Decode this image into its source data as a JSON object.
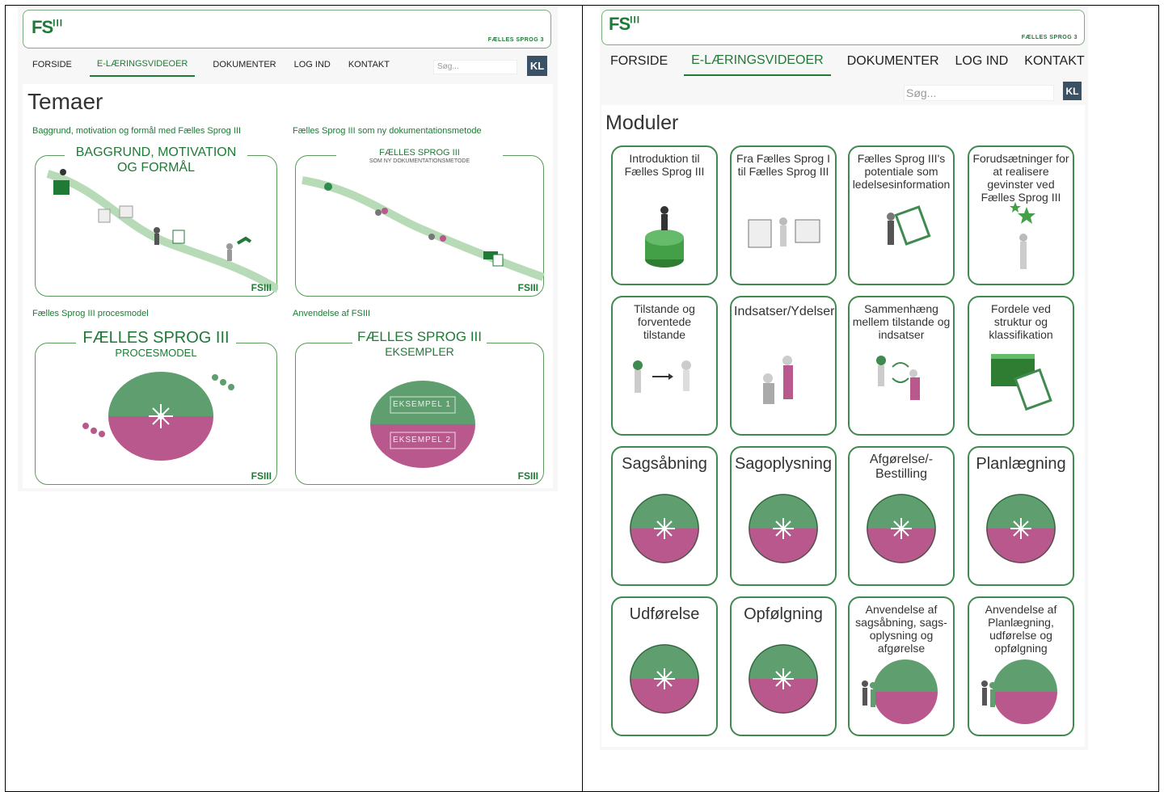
{
  "brand": {
    "logo": "FS",
    "logo_suffix": "III",
    "tagline": "FÆLLES SPROG 3",
    "accent": "#1f7a36",
    "green": "#5f9e6e",
    "pink": "#b8588c"
  },
  "nav": {
    "items": [
      "FORSIDE",
      "E-LÆRINGSVIDEOER",
      "DOKUMENTER",
      "LOG IND",
      "KONTAKT"
    ],
    "active": 1,
    "search_placeholder": "Søg...",
    "kl_label": "KL"
  },
  "left": {
    "title": "Temaer",
    "sections": [
      {
        "heading": "Baggrund, motivation og formål med Fælles Sprog III",
        "thumb_title": "BAGGRUND, MOTIVATION OG FORMÅL",
        "thumb_sub": ""
      },
      {
        "heading": "Fælles Sprog III som ny dokumentationsmetode",
        "thumb_title": "FÆLLES SPROG III",
        "thumb_sub": "SOM NY DOKUMENTATIONSMETODE"
      },
      {
        "heading": "Fælles Sprog III procesmodel",
        "thumb_title": "FÆLLES SPROG III",
        "thumb_sub": "PROCESMODEL"
      },
      {
        "heading": "Anvendelse af FSIII",
        "thumb_title": "FÆLLES SPROG III",
        "thumb_sub": "EKSEMPLER"
      }
    ],
    "examples": [
      "EKSEMPEL 1",
      "EKSEMPEL 2"
    ],
    "fs_mark": "FSIII"
  },
  "right": {
    "title": "Moduler",
    "modules": [
      {
        "label": "Introduktion til Fælles Sprog III",
        "icon": "chart-figure-icon"
      },
      {
        "label": "Fra Fælles Sprog I til Fælles Sprog III",
        "icon": "fsi-fsiii-icon"
      },
      {
        "label": "Fælles Sprog III's potentiale som ledelsesinformation",
        "icon": "clipboard-figure-icon"
      },
      {
        "label": "Forudsætninger for at realisere gevinster ved Fælles Sprog III",
        "icon": "stars-figure-icon"
      },
      {
        "label": "Tilstande og forventede tilstande",
        "icon": "arrow-figures-icon"
      },
      {
        "label": "Indsatser/Ydelser",
        "icon": "care-figures-icon"
      },
      {
        "label": "Sammenhæng mellem tilstande og indsatser",
        "icon": "cycle-figures-icon"
      },
      {
        "label": "Fordele ved struktur og klassifikation",
        "icon": "files-clipboard-icon"
      },
      {
        "label": "Sagsåbning",
        "icon": "process-wheel-icon"
      },
      {
        "label": "Sagoplysning",
        "icon": "process-wheel-icon"
      },
      {
        "label": "Afgørelse/-Bestilling",
        "icon": "process-wheel-icon"
      },
      {
        "label": "Planlægning",
        "icon": "process-wheel-icon"
      },
      {
        "label": "Udførelse",
        "icon": "process-wheel-icon"
      },
      {
        "label": "Opfølgning",
        "icon": "process-wheel-icon"
      },
      {
        "label": "Anvendelse af sagsåbning, sags-oplysning og afgørelse",
        "icon": "wheel-figures-icon"
      },
      {
        "label": "Anvendelse af Planlægning, udførelse og opfølgning",
        "icon": "wheel-figures-icon"
      }
    ]
  }
}
